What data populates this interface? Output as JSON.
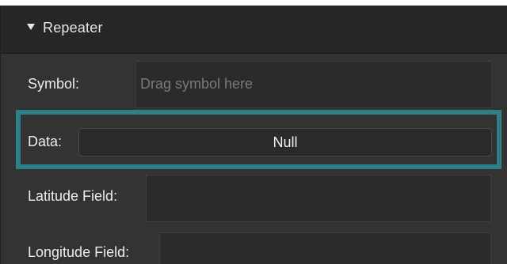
{
  "panel": {
    "title": "Repeater"
  },
  "rows": {
    "symbol": {
      "label": "Symbol:",
      "placeholder": "Drag symbol here"
    },
    "data": {
      "label": "Data:",
      "value": "Null"
    },
    "latitude": {
      "label": "Latitude Field:"
    },
    "longitude": {
      "label": "Longitude Field:"
    }
  },
  "colors": {
    "panel_bg": "#333333",
    "header_bg": "#262626",
    "highlight": "#2f7f86",
    "text": "#ececec",
    "placeholder": "#7a7a7a"
  },
  "icons": {
    "collapse": "caret-down-icon"
  }
}
